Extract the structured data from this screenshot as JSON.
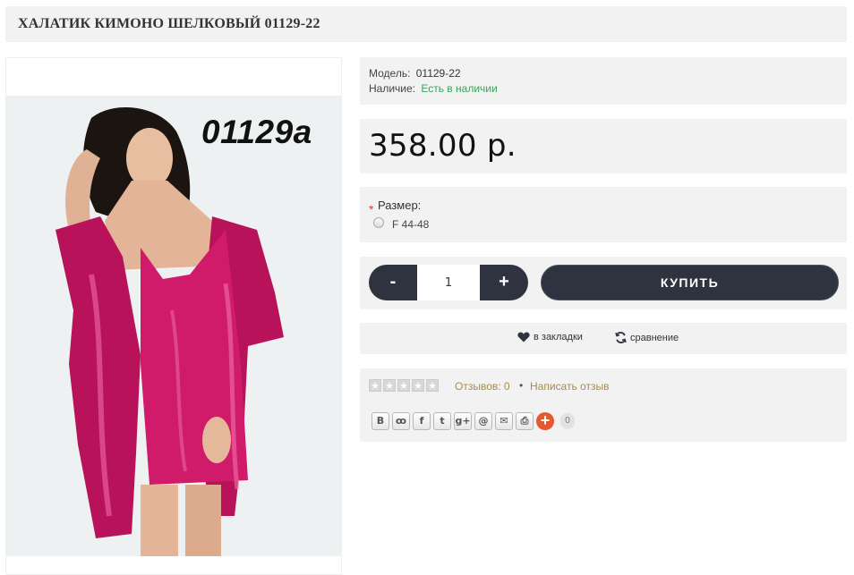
{
  "header": {
    "title": "ХАЛАТИК КИМОНО ШЕЛКОВЫЙ 01129-22"
  },
  "image": {
    "sku_overlay": "01129a",
    "dress_color": "#c2185b",
    "background": "#eef1f2"
  },
  "info": {
    "model_label": "Модель:",
    "model_value": "01129-22",
    "stock_label": "Наличие:",
    "stock_value": "Есть в наличии",
    "stock_color": "#3aa35b"
  },
  "price": {
    "value": "358.00 р."
  },
  "option": {
    "required_mark": "*",
    "label": "Размер:",
    "choices": [
      "F 44-48"
    ]
  },
  "cart": {
    "minus": "-",
    "plus": "+",
    "quantity": "1",
    "buy_label": "КУПИТЬ",
    "button_color": "#2f3340"
  },
  "actions": {
    "wishlist": "в закладки",
    "compare": "сравнение"
  },
  "reviews": {
    "rating": 0,
    "max_rating": 5,
    "count_text": "Отзывов: 0",
    "separator": "•",
    "write_text": "Написать отзыв",
    "link_color": "#a88c4a"
  },
  "share": {
    "buttons": [
      {
        "icon": "vk-icon",
        "glyph": "В"
      },
      {
        "icon": "odnoklassniki-icon",
        "glyph": "ꝏ"
      },
      {
        "icon": "facebook-icon",
        "glyph": "f"
      },
      {
        "icon": "twitter-icon",
        "glyph": "t"
      },
      {
        "icon": "google-plus-icon",
        "glyph": "g+"
      },
      {
        "icon": "mailru-icon",
        "glyph": "@"
      },
      {
        "icon": "email-icon",
        "glyph": "✉"
      },
      {
        "icon": "print-icon",
        "glyph": "⎙"
      }
    ],
    "more": "+",
    "count": "0"
  }
}
